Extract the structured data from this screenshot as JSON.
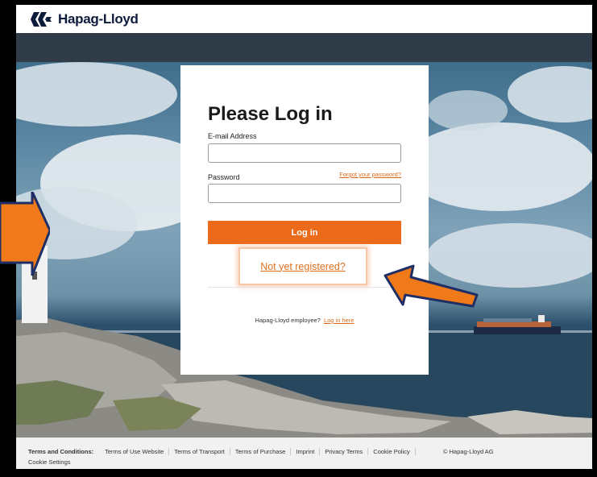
{
  "brand": {
    "name": "Hapag-Lloyd",
    "color": "#0d1c3c"
  },
  "login": {
    "title": "Please Log in",
    "email_label": "E-mail Address",
    "email_value": "",
    "password_label": "Password",
    "password_value": "",
    "forgot_link": "Forgot your password?",
    "login_button": "Log in",
    "register_link": "Not yet registered?",
    "employee_text": "Hapag-Lloyd employee?",
    "employee_link": "Log in here"
  },
  "footer": {
    "terms_heading": "Terms and Conditions:",
    "links": [
      "Terms of Use Website",
      "Terms of Transport",
      "Terms of Purchase",
      "Imprint",
      "Privacy Terms",
      "Cookie Policy"
    ],
    "copyright": "© Hapag-Lloyd AG",
    "cookie_settings": "Cookie Settings"
  },
  "colors": {
    "accent": "#ec6b1a",
    "navbar": "#2f3b47",
    "annotation_arrow": "#f07a1a",
    "arrow_outline": "#1f2f66"
  }
}
